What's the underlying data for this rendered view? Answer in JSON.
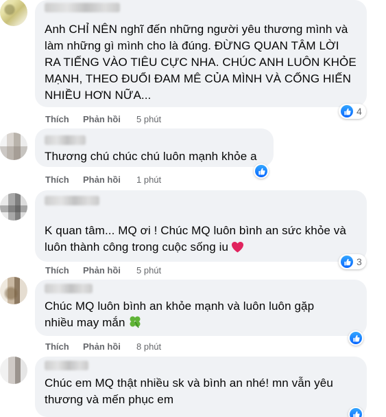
{
  "actions": {
    "like": "Thích",
    "reply": "Phản hồi"
  },
  "comments": [
    {
      "text": "Anh CHỈ NÊN nghĩ đến những người yêu thương mình và\nlàm những gì mình cho là đúng. ĐỪNG QUAN TÂM LỜI\nRA TIẾNG VÀO TIÊU CỰC NHA. CHÚC ANH LUÔN KHỎE\nMẠNH, THEO ĐUỔI ĐAM MÊ CỦA MÌNH VÀ CỐNG HIẾN\nNHIỀU HƠN NỮA...",
      "time": "5 phút",
      "reactions": "4"
    },
    {
      "text": "Thương chú chúc chú luôn mạnh khỏe a",
      "time": "1 phút",
      "reactions": ""
    },
    {
      "text": "K quan tâm... MQ ơi ! Chúc MQ luôn bình an sức khỏe và\nluôn thành công trong cuộc sống iu",
      "emoji": "heart",
      "time": "5 phút",
      "reactions": "3"
    },
    {
      "text": "Chúc MQ luôn bình an khỏe mạnh và luôn luôn gặp\nnhiều may mắn",
      "emoji": "clover",
      "time": "8 phút",
      "reactions": ""
    },
    {
      "text": "Chúc em MQ thật nhiều sk và bình an nhé! mn vẫn yêu\nthương và mến phục em",
      "time": "",
      "reactions": ""
    }
  ],
  "colors": {
    "bubble": "#f0f2f5",
    "action_text": "#65676b",
    "like_blue": "#0866ff",
    "heart": "#e0245e",
    "clover": "#5fb336"
  },
  "icons": {
    "like": "thumbs-up-icon",
    "heart": "heart-icon",
    "clover": "four-leaf-clover-icon"
  }
}
